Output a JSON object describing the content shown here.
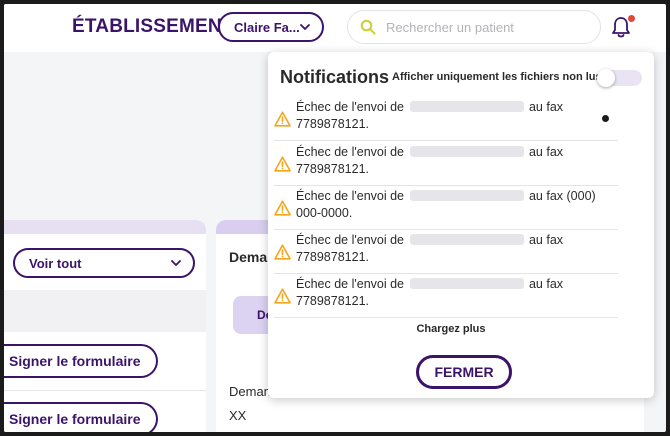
{
  "header": {
    "brand": "ÉTABLISSEMENT",
    "user_menu_label": "Claire Fa...",
    "search_placeholder": "Rechercher un patient",
    "bell_has_alert": true
  },
  "background": {
    "filter_label": "Voir tout",
    "sign_button_1": "Signer le formulaire",
    "sign_button_2": "Signer le formulaire",
    "card_title": "Deman",
    "tab_label": "De",
    "field_label": "Deman",
    "field_value": "XX"
  },
  "notifications": {
    "title": "Notifications",
    "filter_label": "Afficher uniquement les fichiers non lus",
    "unread_only": false,
    "items": [
      {
        "prefix": "Échec de l'envoi de",
        "suffix": "au fax 7789878121.",
        "unread": true
      },
      {
        "prefix": "Échec de l'envoi de",
        "suffix": "au fax 7789878121.",
        "unread": false
      },
      {
        "prefix": "Échec de l'envoi de",
        "suffix": "au fax (000) 000-0000.",
        "unread": false
      },
      {
        "prefix": "Échec de l'envoi de",
        "suffix": "au fax 7789878121.",
        "unread": false
      },
      {
        "prefix": "Échec de l'envoi de",
        "suffix": "au fax 7789878121.",
        "unread": false
      }
    ],
    "load_more": "Chargez plus",
    "close_label": "FERMER"
  },
  "colors": {
    "brand": "#3b1469",
    "warning": "#f2a51d",
    "alert_dot": "#e0483e",
    "search_icon": "#c9d13a"
  }
}
